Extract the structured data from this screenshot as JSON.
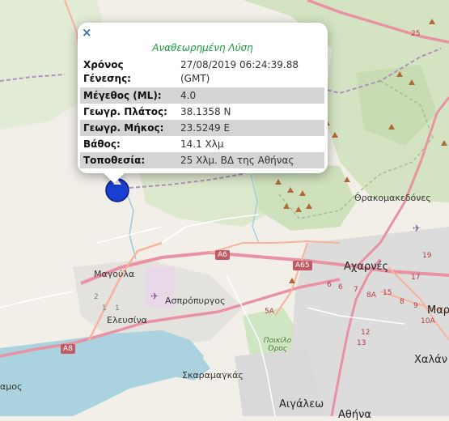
{
  "popup": {
    "close_icon": "close-icon",
    "title": "Αναθεωρημένη Λύση",
    "rows": [
      {
        "label": "Χρόνος Γένεσης:",
        "value": "27/08/2019 06:24:39.88 (GMT)"
      },
      {
        "label": "Μέγεθος (ML):",
        "value": "4.0"
      },
      {
        "label": "Γεωγρ. Πλάτος:",
        "value": "38.1358 N"
      },
      {
        "label": "Γεωγρ. Μήκος:",
        "value": "23.5249 E"
      },
      {
        "label": "Βάθος:",
        "value": "14.1 Χλμ"
      },
      {
        "label": "Τοποθεσία:",
        "value": "25 Χλμ. ΒΔ της Αθήνας"
      }
    ]
  },
  "map": {
    "places": {
      "thrakomakedones": "Θρακομακεδόνες",
      "acharnes": "Αχαρνές",
      "magoula": "Μαγούλα",
      "aspropyrgos": "Ασπρόπυργος",
      "eleusina": "Ελευσίνα",
      "skaramangas": "Σκαραμαγκάς",
      "aigaleo": "Αιγάλεω",
      "chalandri": "Χαλάν",
      "mar": "Μαρ",
      "amos": "αμος",
      "poikilo_oros": "Ποικίλο Όρος",
      "athina_partial": "Αθήνα"
    },
    "roads": {
      "a6": "A6",
      "a65": "A65",
      "a8": "A8",
      "r25": "25",
      "r5a": "5A",
      "r6a": "6",
      "r6b": "6",
      "r7": "7",
      "r8a": "8A",
      "r15": "15",
      "r19": "19",
      "r17": "17",
      "r12": "12",
      "r13": "13",
      "r8": "8",
      "r9": "9",
      "r10a": "10A",
      "r1a": "1",
      "r1b": "1",
      "r2": "2"
    },
    "colors": {
      "land": "#f2efe9",
      "forest": "#d8e8c8",
      "urban": "#dddddd",
      "sea": "#aad3df",
      "motorway": "#e892a2",
      "primary": "#f9b29c",
      "boundary": "#a080b0",
      "marker": "#1a3fd0"
    },
    "marker_icon": "earthquake-marker-icon"
  }
}
